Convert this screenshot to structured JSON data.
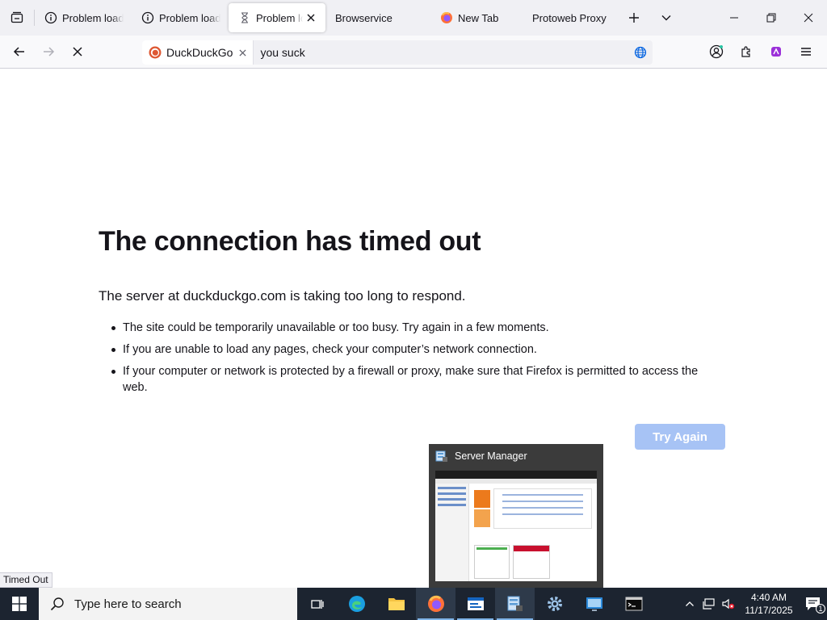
{
  "browser": {
    "tabs": [
      {
        "title": "Problem loadi",
        "icon": "info-icon",
        "active": false
      },
      {
        "title": "Problem loadi",
        "icon": "info-icon",
        "active": false
      },
      {
        "title": "Problem loa",
        "icon": "hourglass-icon",
        "active": true
      },
      {
        "title": "Browservice",
        "icon": "none",
        "active": false
      },
      {
        "title": "New Tab",
        "icon": "firefox-icon",
        "active": false
      },
      {
        "title": "Protoweb Proxy",
        "icon": "none",
        "active": false
      }
    ],
    "search_engine": "DuckDuckGo",
    "url_text": "you suck",
    "loading": true
  },
  "page": {
    "title": "The connection has timed out",
    "description": "The server at duckduckgo.com is taking too long to respond.",
    "bullets": [
      "The site could be temporarily unavailable or too busy. Try again in a few moments.",
      "If you are unable to load any pages, check your computer’s network connection.",
      "If your computer or network is protected by a firewall or proxy, make sure that Firefox is permitted to access the web."
    ],
    "try_again_label": "Try Again",
    "status_text": "Timed Out"
  },
  "thumbnail": {
    "title": "Server Manager"
  },
  "taskbar": {
    "search_placeholder": "Type here to search",
    "time": "4:40 AM",
    "date": "11/17/2025",
    "notification_count": "1"
  },
  "colors": {
    "accent_button": "#a7c3f5",
    "taskbar_bg": "#1c2430",
    "tabstrip_bg": "#f0f0f4"
  }
}
